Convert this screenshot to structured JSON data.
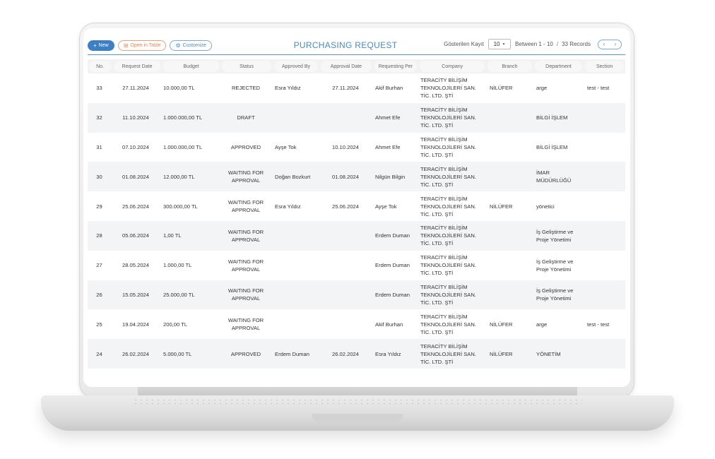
{
  "toolbar": {
    "new_label": "New",
    "open_table_label": "Open in Table",
    "customize_label": "Customize"
  },
  "page": {
    "title": "PURCHASING REQUEST"
  },
  "pager": {
    "shown_label": "Gösterilen Kayıt",
    "page_size": "10",
    "range": "Between 1 - 10",
    "sep": "/",
    "total": "33 Records"
  },
  "columns": [
    "No.",
    "Request Date",
    "Budget",
    "Status",
    "Approved By",
    "Approval Date",
    "Requesting Per",
    "Company",
    "Branch",
    "Department",
    "Section"
  ],
  "rows": [
    [
      "33",
      "27.11.2024",
      "10.000,00 TL",
      "REJECTED",
      "Esra Yıldız",
      "27.11.2024",
      "Akif Burhan",
      "TERACİTY BİLİŞİM TEKNOLOJİLERİ SAN. TİC. LTD. ŞTİ",
      "NİLÜFER",
      "arge",
      "test - test"
    ],
    [
      "32",
      "11.10.2024",
      "1.000.000,00 TL",
      "DRAFT",
      "",
      "",
      "Ahmet Efe",
      "TERACİTY BİLİŞİM TEKNOLOJİLERİ SAN. TİC. LTD. ŞTİ",
      "",
      "BİLGİ İŞLEM",
      ""
    ],
    [
      "31",
      "07.10.2024",
      "1.000.000,00 TL",
      "APPROVED",
      "Ayşe Tok",
      "10.10.2024",
      "Ahmet Efe",
      "TERACİTY BİLİŞİM TEKNOLOJİLERİ SAN. TİC. LTD. ŞTİ",
      "",
      "BİLGİ İŞLEM",
      ""
    ],
    [
      "30",
      "01.08.2024",
      "12.000,00 TL",
      "WAITING FOR APPROVAL",
      "Doğan Bozkurt",
      "01.08.2024",
      "Nilgün Bilgin",
      "TERACİTY BİLİŞİM TEKNOLOJİLERİ SAN. TİC. LTD. ŞTİ",
      "",
      "İMAR MÜDÜRLÜĞÜ",
      ""
    ],
    [
      "29",
      "25.06.2024",
      "300.000,00 TL",
      "WAITING FOR APPROVAL",
      "Esra Yıldız",
      "25.06.2024",
      "Ayşe Tok",
      "TERACİTY BİLİŞİM TEKNOLOJİLERİ SAN. TİC. LTD. ŞTİ",
      "NİLÜFER",
      "yönetici",
      ""
    ],
    [
      "28",
      "05.06.2024",
      "1,00 TL",
      "WAITING FOR APPROVAL",
      "",
      "",
      "Erdem Duman",
      "TERACİTY BİLİŞİM TEKNOLOJİLERİ SAN. TİC. LTD. ŞTİ",
      "",
      "İş Geliştirme ve Proje Yönetimi",
      ""
    ],
    [
      "27",
      "28.05.2024",
      "1.000,00 TL",
      "WAITING FOR APPROVAL",
      "",
      "",
      "Erdem Duman",
      "TERACİTY BİLİŞİM TEKNOLOJİLERİ SAN. TİC. LTD. ŞTİ",
      "",
      "İş Geliştirme ve Proje Yönetimi",
      ""
    ],
    [
      "26",
      "15.05.2024",
      "25.000,00 TL",
      "WAITING FOR APPROVAL",
      "",
      "",
      "Erdem Duman",
      "TERACİTY BİLİŞİM TEKNOLOJİLERİ SAN. TİC. LTD. ŞTİ",
      "",
      "İş Geliştirme ve Proje Yönetimi",
      ""
    ],
    [
      "25",
      "19.04.2024",
      "200,00 TL",
      "WAITING FOR APPROVAL",
      "",
      "",
      "Akif Burhan",
      "TERACİTY BİLİŞİM TEKNOLOJİLERİ SAN. TİC. LTD. ŞTİ",
      "NİLÜFER",
      "arge",
      "test - test"
    ],
    [
      "24",
      "26.02.2024",
      "5.000,00 TL",
      "APPROVED",
      "Erdem Duman",
      "26.02.2024",
      "Esra Yıldız",
      "TERACİTY BİLİŞİM TEKNOLOJİLERİ SAN. TİC. LTD. ŞTİ",
      "NİLÜFER",
      "YÖNETİM",
      ""
    ]
  ],
  "colors": {
    "accent": "#3d7fc4",
    "orange": "#e6895a",
    "row_alt": "#f2f4f6"
  },
  "icons": {
    "new": "plus-icon",
    "table": "grid-icon",
    "customize": "gear-icon",
    "prev": "chevron-left-icon",
    "next": "chevron-right-icon"
  }
}
